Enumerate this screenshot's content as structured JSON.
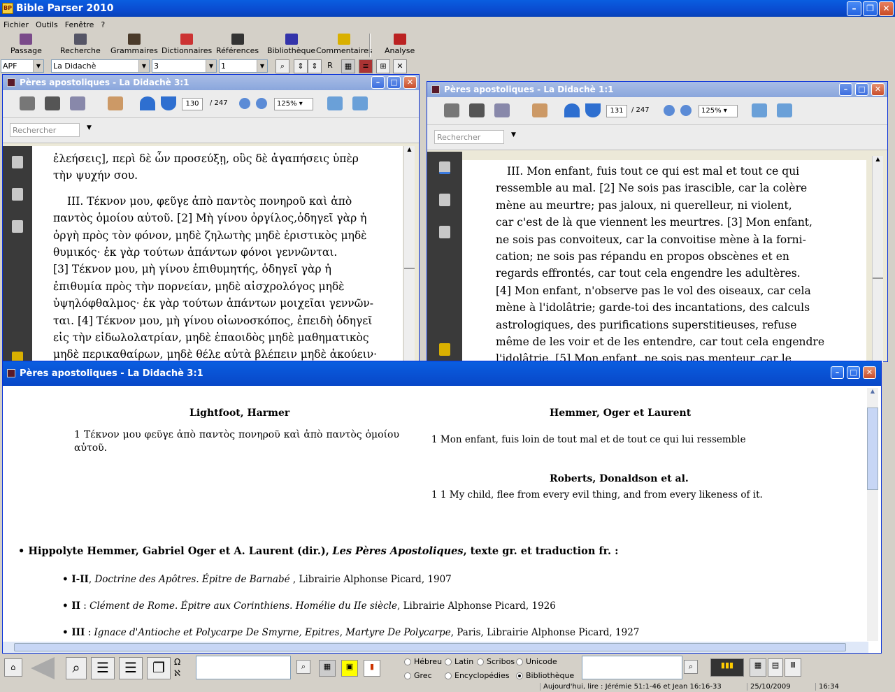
{
  "app": {
    "title": "Bible Parser 2010"
  },
  "menu": [
    "Fichier",
    "Outils",
    "Fenêtre",
    "?"
  ],
  "toolbar": [
    "Passage",
    "Recherche",
    "Grammaires",
    "Dictionnaires",
    "Références",
    "Bibliothèque",
    "Commentaires",
    "Analyse"
  ],
  "selectors": {
    "version": "APF",
    "book": "La Didachè",
    "chapter": "3",
    "verse": "1",
    "r_button": "R"
  },
  "left_pdf": {
    "title": "Pères apostoliques - La Didachè 3:1",
    "page": "130",
    "total": "/ 247",
    "zoom": "125%",
    "search_placeholder": "Rechercher",
    "lines": [
      "ἐλεήσεις], περὶ δὲ ὧν προσεύξῃ, οὓς δὲ ἀγαπήσεις ὑπὲρ",
      "τὴν ψυχήν σου.",
      "III. Τέκνον μου, φεῦγε ἀπὸ παντὸς πονηροῦ καὶ ἀπὸ",
      "παντὸς ὁμοίου αὐτοῦ. [2] Μὴ γίνου ὀργίλος,ὁδηγεῖ γὰρ ἡ",
      "ὀργὴ πρὸς τὸν φόνον, μηδὲ ζηλωτὴς μηδὲ ἐριστικὸς μηδὲ",
      "θυμικός· ἐκ γὰρ τούτων ἁπάντων φόνοι γεννῶνται.",
      "[3] Τέκνον μου, μὴ γίνου ἐπιθυμητής, ὁδηγεῖ γὰρ ἡ",
      "ἐπιθυμία πρὸς τὴν πορνείαν, μηδὲ αἰσχρολόγος μηδὲ",
      "ὑψηλόφθαλμος· ἐκ γὰρ τούτων ἁπάντων μοιχεῖαι γεννῶν-",
      "ται. [4] Τέκνον μου, μὴ γίνου οἰωνοσκόπος, ἐπειδὴ ὁδηγεῖ",
      "εἰς τὴν εἰδωλολατρίαν, μηδὲ ἐπαοιδὸς μηδὲ μαθηματικὸς",
      "μηδὲ περικαθαίρων, μηδὲ θέλε αὐτὰ βλέπειν μηδὲ ἀκούειν·"
    ]
  },
  "right_pdf": {
    "title": "Pères apostoliques - La Didachè 1:1",
    "page": "131",
    "total": "/ 247",
    "zoom": "125%",
    "search_placeholder": "Rechercher",
    "lines": [
      "III. Mon enfant, fuis tout ce qui est mal et tout ce qui",
      "ressemble au mal. [2] Ne sois pas irascible, car la colère",
      "mène au meurtre; pas jaloux, ni querelleur, ni violent,",
      "car c'est de là que viennent les meurtres. [3] Mon enfant,",
      "ne sois pas convoiteux, car la convoitise mène à la forni-",
      "cation; ne sois pas répandu en propos obscènes et en",
      "regards effrontés, car tout cela engendre les adultères.",
      "[4] Mon enfant, n'observe pas le vol des oiseaux, car cela",
      "mène à l'idolâtrie; garde-toi des incantations, des calculs",
      "astrologiques, des purifications superstitieuses, refuse",
      "même de les voir et de les entendre, car tout cela engendre",
      "l'idolâtrie. [5] Mon enfant, ne sois pas menteur, car le"
    ]
  },
  "bottom": {
    "title": "Pères apostoliques - La Didachè 3:1",
    "col1_head": "Lightfoot, Harmer",
    "col1_text": "1 Τέκνον μου φεῦγε ἀπὸ παντὸς πονηροῦ καὶ ἀπὸ παντὸς ὁμοίου αὐτοῦ.",
    "col2_head": "Hemmer, Oger et Laurent",
    "col2_text": "1 Mon enfant, fuis loin de tout mal et de tout ce qui lui ressemble",
    "col3_head": "Roberts, Donaldson et al.",
    "col3_text": "1 1 My child, flee from every evil thing, and from every likeness of it.",
    "biblio_bold": "• Hippolyte Hemmer, Gabriel Oger et A. Laurent (dir.),",
    "biblio_it": "Les Pères Apostoliques",
    "biblio_rest": ", texte gr. et traduction fr. :",
    "items": [
      {
        "num": "• I-II",
        "it": "Doctrine des Apôtres. Épitre de Barnabé",
        "rest": " , Librairie Alphonse Picard, 1907"
      },
      {
        "num": "• II",
        "it": "Clément de Rome. Épitre aux Corinthiens. Homélie du IIe siècle",
        "rest": ", Librairie Alphonse Picard, 1926"
      },
      {
        "num": "• III",
        "it": "Ignace d'Antioche et Polycarpe De Smyrne, Epitres, Martyre De Polycarpe",
        "rest": ", Paris, Librairie Alphonse Picard, 1927"
      }
    ]
  },
  "radios": [
    {
      "label": "Hébreu",
      "on": false
    },
    {
      "label": "Latin",
      "on": false
    },
    {
      "label": "Scribos",
      "on": false
    },
    {
      "label": "Unicode",
      "on": false
    },
    {
      "label": "Grec",
      "on": false
    },
    {
      "label": "Encyclopédies",
      "on": false
    },
    {
      "label": "Bibliothèque",
      "on": true
    }
  ],
  "status": {
    "reading": "Aujourd'hui, lire : Jérémie 51:1-46 et Jean 16:16-33",
    "date": "25/10/2009",
    "time": "16:34"
  }
}
